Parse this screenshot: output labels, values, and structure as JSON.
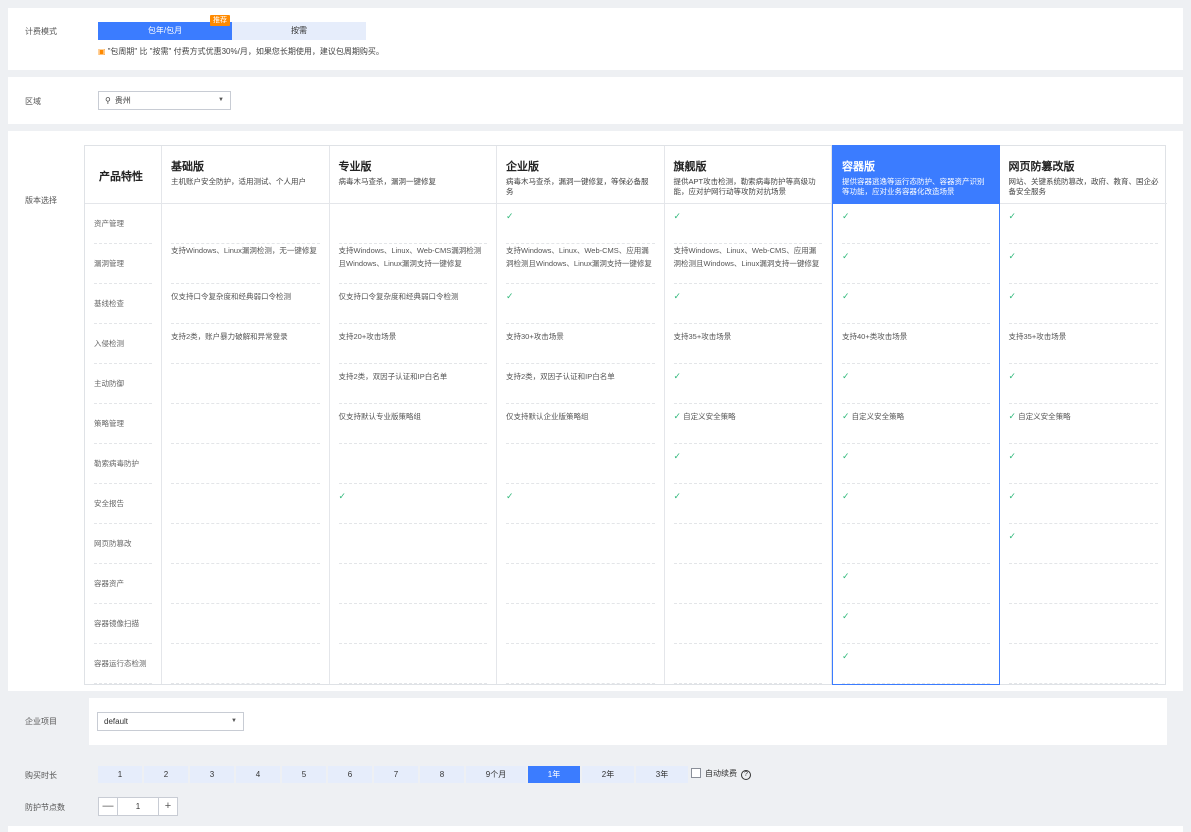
{
  "billing": {
    "label": "计费模式",
    "options": [
      "包年/包月",
      "按需"
    ],
    "selected": "包年/包月",
    "badge": "推荐",
    "tip": "\"包周期\" 比 \"按需\" 付费方式优惠30%/月，如果您长期使用，建议包周期购买。"
  },
  "region": {
    "label": "区域",
    "value": "贵州"
  },
  "version": {
    "label": "版本选择",
    "feature_header": "产品特性",
    "features": [
      "资产管理",
      "漏洞管理",
      "基线检查",
      "入侵检测",
      "主动防御",
      "策略管理",
      "勒索病毒防护",
      "安全报告",
      "网页防篡改",
      "容器资产",
      "容器镜像扫描",
      "容器运行态检测"
    ],
    "editions": [
      {
        "name": "基础版",
        "desc": "主机账户安全防护，适用测试、个人用户",
        "cells": [
          "",
          "支持Windows、Linux漏洞检测，无一键修复",
          "仅支持口令复杂度和经典弱口令检测",
          "支持2类，账户暴力破解和异常登录",
          "",
          "",
          "",
          "",
          "",
          "",
          "",
          ""
        ]
      },
      {
        "name": "专业版",
        "desc": "病毒木马查杀，漏洞一键修复",
        "cells": [
          "",
          "支持Windows、Linux、Web-CMS漏洞检测且Windows、Linux漏洞支持一键修复",
          "仅支持口令复杂度和经典弱口令检测",
          "支持20+攻击场景",
          "支持2类，双因子认证和IP白名单",
          "仅支持默认专业版策略组",
          "",
          "✓",
          "",
          "",
          "",
          ""
        ]
      },
      {
        "name": "企业版",
        "desc": "病毒木马查杀，漏洞一键修复，等保必备服务",
        "cells": [
          "✓",
          "支持Windows、Linux、Web-CMS、应用漏洞检测且Windows、Linux漏洞支持一键修复",
          "✓",
          "支持30+攻击场景",
          "支持2类，双因子认证和IP白名单",
          "仅支持默认企业版策略组",
          "",
          "✓",
          "",
          "",
          "",
          ""
        ]
      },
      {
        "name": "旗舰版",
        "desc": "提供APT攻击检测，勒索病毒防护等高级功能，应对护网行动等攻防对抗场景",
        "cells": [
          "✓",
          "支持Windows、Linux、Web-CMS、应用漏洞检测且Windows、Linux漏洞支持一键修复",
          "✓",
          "支持35+攻击场景",
          "✓",
          "✓ 自定义安全策略",
          "✓",
          "✓",
          "",
          "",
          "",
          ""
        ]
      },
      {
        "name": "容器版",
        "desc": "提供容器逃逸等运行态防护、容器资产识别等功能，应对业务容器化改造场景",
        "cells": [
          "✓",
          "✓",
          "✓",
          "支持40+类攻击场景",
          "✓",
          "✓ 自定义安全策略",
          "✓",
          "✓",
          "",
          "✓",
          "✓",
          "✓"
        ]
      },
      {
        "name": "网页防篡改版",
        "desc": "网站、关键系统防篡改，政府、教育、国企必备安全服务",
        "cells": [
          "✓",
          "✓",
          "✓",
          "支持35+攻击场景",
          "✓",
          "✓ 自定义安全策略",
          "✓",
          "✓",
          "✓",
          "",
          "",
          ""
        ]
      }
    ],
    "selected": "容器版"
  },
  "project": {
    "label": "企业项目",
    "value": "default"
  },
  "duration": {
    "label": "购买时长",
    "options": [
      "1",
      "2",
      "3",
      "4",
      "5",
      "6",
      "7",
      "8",
      "9个月",
      "1年",
      "2年",
      "3年"
    ],
    "selected": "1年",
    "auto_renew": "自动续费",
    "help": "?"
  },
  "nodes": {
    "label": "防护节点数",
    "value": "1",
    "minus": "—",
    "plus": "+"
  },
  "colors": {
    "primary": "#3b7cff",
    "check": "#2fb87a",
    "badge": "#ff8a00"
  }
}
